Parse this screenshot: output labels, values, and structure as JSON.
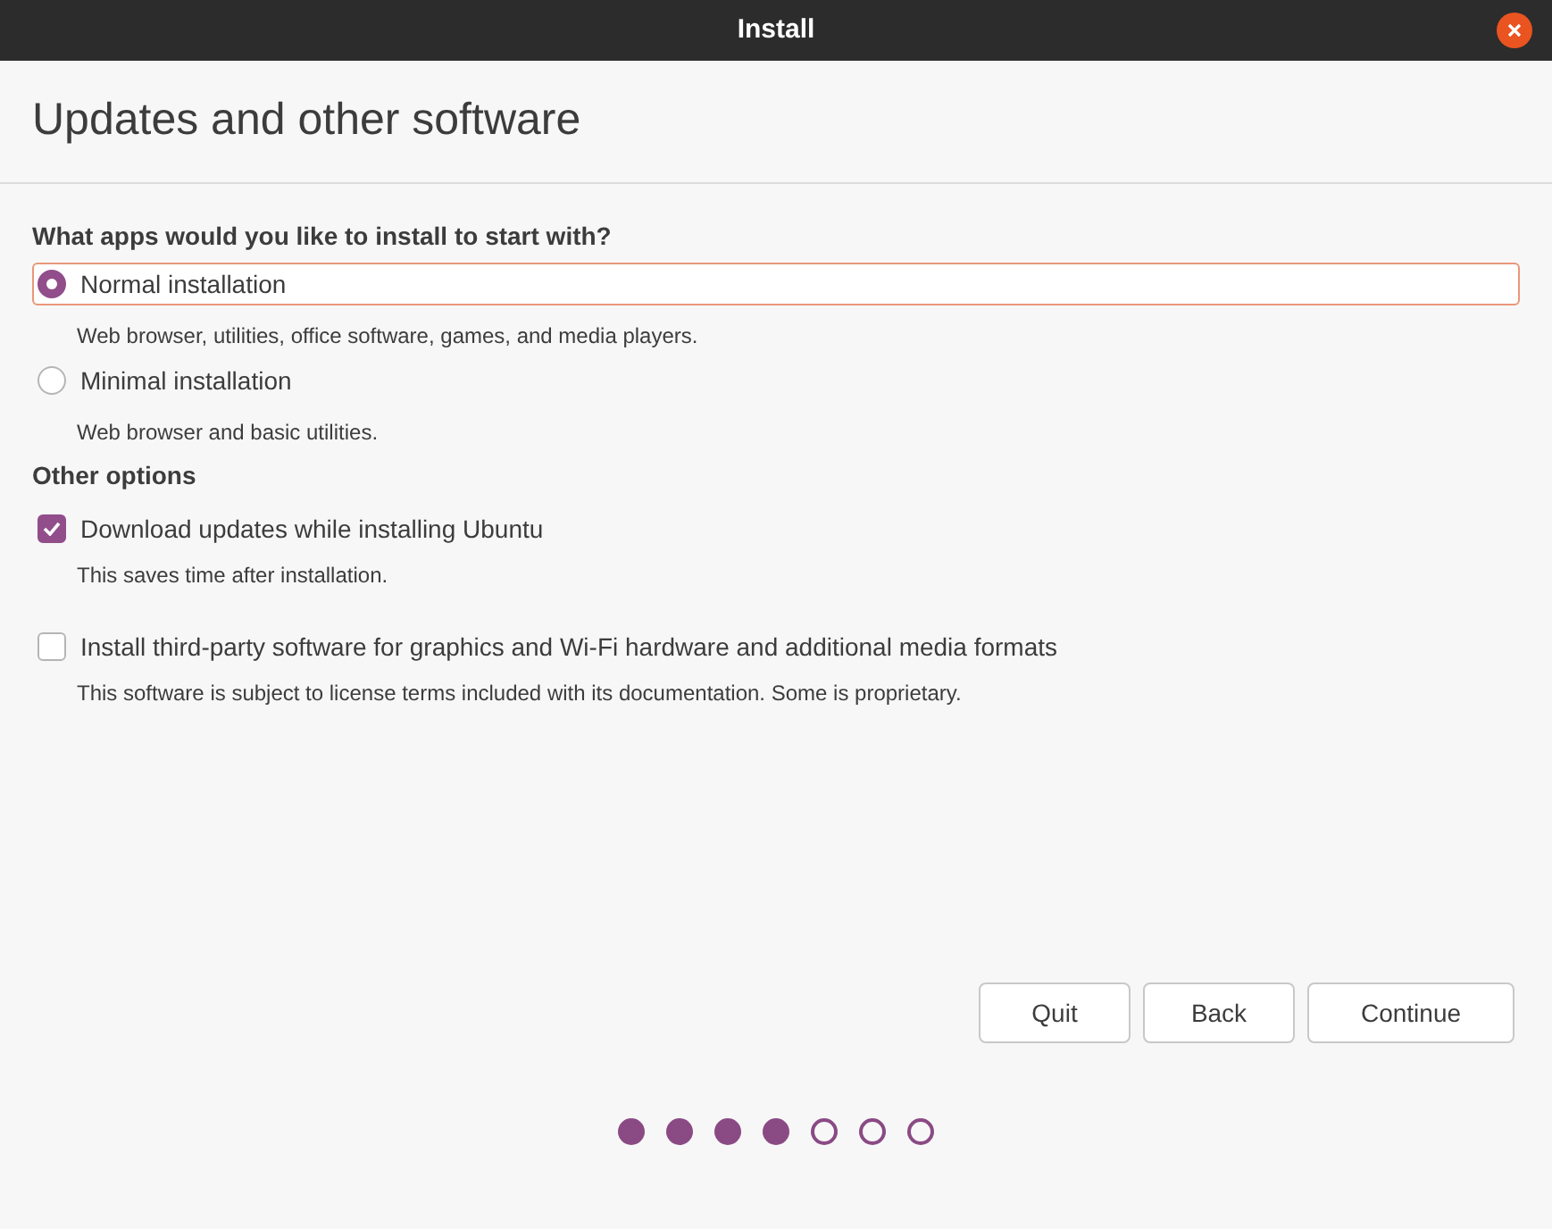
{
  "window": {
    "title": "Install"
  },
  "page_title": "Updates and other software",
  "install_question": "What apps would you like to install to start with?",
  "install_options": [
    {
      "label": "Normal installation",
      "description": "Web browser, utilities, office software, games, and media players.",
      "selected": true
    },
    {
      "label": "Minimal installation",
      "description": "Web browser and basic utilities.",
      "selected": false
    }
  ],
  "other_options_heading": "Other options",
  "other_options": [
    {
      "label": "Download updates while installing Ubuntu",
      "description": "This saves time after installation.",
      "checked": true
    },
    {
      "label": "Install third-party software for graphics and Wi-Fi hardware and additional media formats",
      "description": "This software is subject to license terms included with its documentation. Some is proprietary.",
      "checked": false
    }
  ],
  "buttons": [
    "Quit",
    "Back",
    "Continue"
  ],
  "progress_steps": [
    {
      "completed": true
    },
    {
      "completed": true
    },
    {
      "completed": true
    },
    {
      "completed": true
    },
    {
      "completed": false
    },
    {
      "completed": false
    },
    {
      "completed": false
    }
  ]
}
